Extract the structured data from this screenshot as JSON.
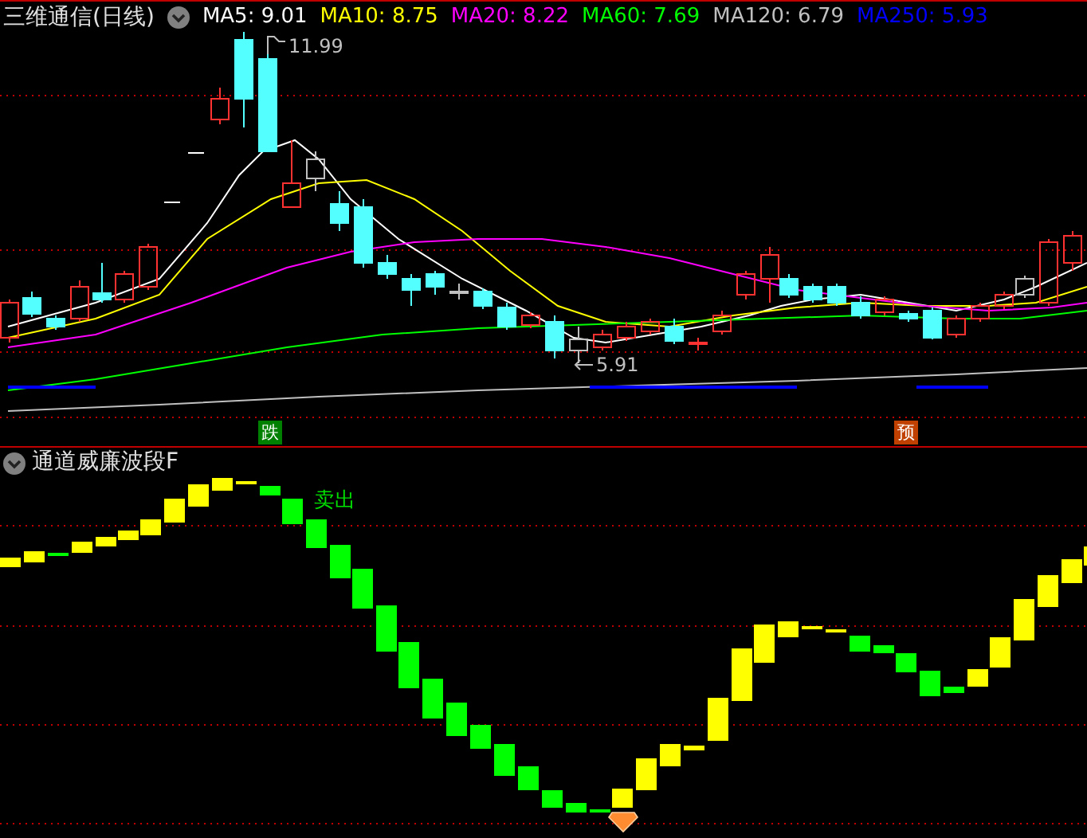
{
  "header": {
    "title": "三维通信(日线)",
    "indicators": [
      {
        "label": "MA5: 9.01",
        "color": "#ffffff"
      },
      {
        "label": "MA10: 8.75",
        "color": "#ffff00"
      },
      {
        "label": "MA20: 8.22",
        "color": "#ff00ff"
      },
      {
        "label": "MA60: 7.69",
        "color": "#00ff00"
      },
      {
        "label": "MA120: 6.79",
        "color": "#c0c0c0"
      },
      {
        "label": "MA250: 5.93",
        "color": "#0000ff"
      }
    ]
  },
  "price_chart": {
    "high_label": "11.99",
    "low_label": "5.91",
    "signals": [
      {
        "text": "跌",
        "color": "#008000"
      },
      {
        "text": "预",
        "color": "#c04000"
      }
    ]
  },
  "lower_panel": {
    "title": "通道威廉波段F",
    "signal_text": "卖出"
  }
}
